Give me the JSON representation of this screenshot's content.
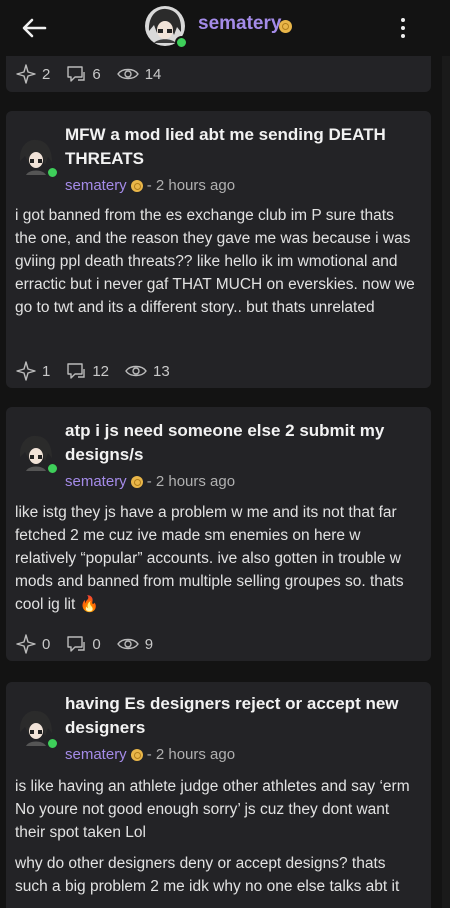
{
  "header": {
    "username": "sematery"
  },
  "top_post_stats": {
    "stars": "2",
    "comments": "6",
    "views": "14"
  },
  "posts": [
    {
      "title": "MFW a mod lied abt me sending DEATH THREATS",
      "author": "sematery",
      "time": "- 2 hours ago",
      "body": "i got banned from the es exchange club im P sure thats the one, and the reason they gave me was because i was gviing ppl death threats?? like hello ik im wmotional and erractic but i never gaf THAT MUCH on everskies. now we go to twt and its  a different story.. but thats unrelated",
      "stats": {
        "stars": "1",
        "comments": "12",
        "views": "13"
      }
    },
    {
      "title": "atp i js need someone else 2 submit my designs/s",
      "author": "sematery",
      "time": "- 2 hours ago",
      "body": "like istg they js have a problem w me and its not that far fetched 2 me cuz ive made sm enemies on here w relatively “popular” accounts. ive also gotten in trouble w mods and banned from multiple selling groupes so. thats cool ig  lit 🔥",
      "stats": {
        "stars": "0",
        "comments": "0",
        "views": "9"
      }
    },
    {
      "title": "having Es designers reject or accept new designers",
      "author": "sematery",
      "time": "- 2 hours ago",
      "body": "is like having an athlete judge other athletes and say ‘erm No youre not good enough sorry’ js cuz they dont want their spot taken Lol",
      "body2": "why do other designers deny or accept designs? thats such a big problem 2 me idk why no one else talks abt it"
    }
  ],
  "colors": {
    "accent": "#a48be8",
    "badge": "#e9b649",
    "online": "#3ecf5a",
    "card": "#232326",
    "background": "#131313"
  }
}
